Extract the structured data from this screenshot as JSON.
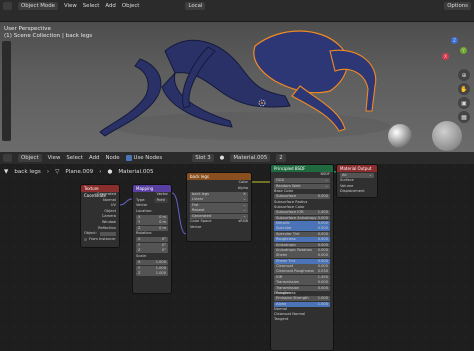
{
  "top_bar": {
    "mode": "Object Mode",
    "menus": [
      "View",
      "Select",
      "Add",
      "Object"
    ],
    "transform": "Local",
    "options": "Options"
  },
  "viewport": {
    "perspective": "User Perspective",
    "collection": "(1) Scene Collection | back legs",
    "axes": [
      "Z",
      "Y",
      "X"
    ]
  },
  "node_header": {
    "type": "Object",
    "menus": [
      "View",
      "Select",
      "Add",
      "Node"
    ],
    "use_nodes": "Use Nodes",
    "slot": "Slot 3",
    "material": "Material.005",
    "users": "2"
  },
  "breadcrumb": {
    "object": "back legs",
    "mesh": "Plane.009",
    "material": "Material.005"
  },
  "nodes": {
    "texcoord": {
      "title": "Texture Coordinate",
      "outputs": [
        "Generated",
        "Normal",
        "UV",
        "Object",
        "Camera",
        "Window",
        "Reflection"
      ],
      "object_label": "Object:",
      "from_instancer": "From Instancer"
    },
    "mapping": {
      "title": "Mapping",
      "output": "Vector",
      "type_label": "Type:",
      "type_value": "Point",
      "vector": "Vector",
      "location": "Location:",
      "location_vals": [
        "0 m",
        "0 m",
        "0 m"
      ],
      "rotation": "Rotation:",
      "rotation_vals": [
        "0°",
        "0°",
        "0°"
      ],
      "scale": "Scale:",
      "scale_vals": [
        "1.000",
        "1.000",
        "1.000"
      ]
    },
    "image": {
      "title": "back legs",
      "outputs": [
        "Color",
        "Alpha"
      ],
      "image_name": "back legs",
      "options": [
        "Linear",
        "Flat",
        "Repeat",
        "Generated"
      ],
      "color_space_label": "Color Space",
      "color_space": "sRGB",
      "vector": "Vector"
    },
    "bsdf": {
      "title": "Principled BSDF",
      "output": "BSDF",
      "distribution": "GGX",
      "subsurface_method": "Random Walk",
      "rows": [
        [
          "Base Color",
          ""
        ],
        [
          "Subsurface",
          "0.000"
        ],
        [
          "Subsurface Radius",
          ""
        ],
        [
          "Subsurface Color",
          ""
        ],
        [
          "Subsurface IOR",
          "1.400"
        ],
        [
          "Subsurface Anisotropy",
          "0.000"
        ],
        [
          "Metallic",
          "0.000"
        ],
        [
          "Specular",
          "0.500"
        ],
        [
          "Specular Tint",
          "0.000"
        ],
        [
          "Roughness",
          "0.500"
        ],
        [
          "Anisotropic",
          "0.000"
        ],
        [
          "Anisotropic Rotation",
          "0.000"
        ],
        [
          "Sheen",
          "0.000"
        ],
        [
          "Sheen Tint",
          "0.500"
        ],
        [
          "Clearcoat",
          "0.000"
        ],
        [
          "Clearcoat Roughness",
          "0.030"
        ],
        [
          "IOR",
          "1.450"
        ],
        [
          "Transmission",
          "0.000"
        ],
        [
          "Transmission Roughness",
          "0.000"
        ],
        [
          "Emission",
          ""
        ],
        [
          "Emission Strength",
          "1.000"
        ],
        [
          "Alpha",
          "1.000"
        ],
        [
          "Normal",
          ""
        ],
        [
          "Clearcoat Normal",
          ""
        ],
        [
          "Tangent",
          ""
        ]
      ]
    },
    "output": {
      "title": "Material Output",
      "target": "All",
      "inputs": [
        "Surface",
        "Volume",
        "Displacement"
      ]
    }
  }
}
